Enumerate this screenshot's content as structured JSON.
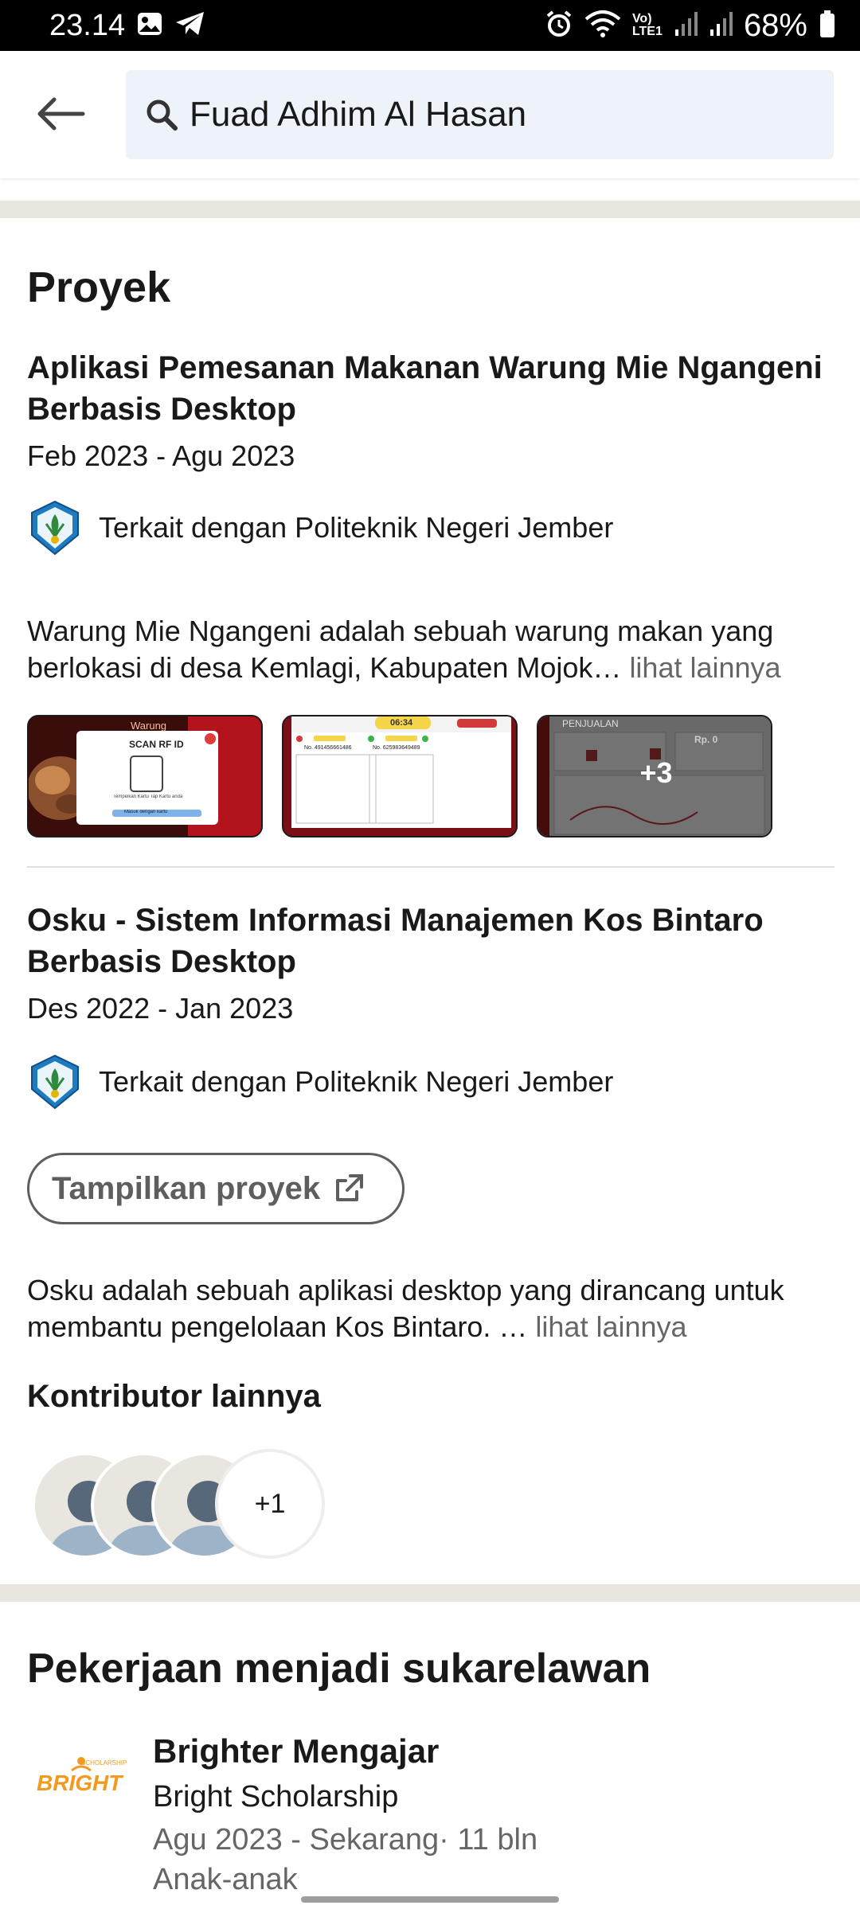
{
  "status_bar": {
    "time": "23.14",
    "battery": "68%",
    "network_label": "Vo) LTE1",
    "icons": [
      "gallery-icon",
      "telegram-icon",
      "alarm-icon",
      "wifi-icon",
      "signal-icon",
      "signal-icon",
      "battery-icon"
    ]
  },
  "header": {
    "search_text": "Fuad Adhim Al Hasan"
  },
  "projects": {
    "section_title": "Proyek",
    "items": [
      {
        "title": "Aplikasi Pemesanan Makanan Warung Mie Ngangeni Berbasis Desktop",
        "date": "Feb 2023 - Agu 2023",
        "associated": "Terkait dengan Politeknik Negeri Jember",
        "description": "Warung Mie Ngangeni adalah sebuah warung makan yang berlokasi di desa Kemlagi, Kabupaten Mojok…",
        "see_more": "lihat lainnya",
        "thumb1_title": "SCAN RF ID",
        "thumb1_caption": "Tempelkan Kartu Tap Kartu anda",
        "thumb1_button": "Masuk dengan kartu",
        "thumb1_banner": "Warung",
        "thumb2_timer": "06:34",
        "thumb2_no1": "No. 491456661486",
        "thumb2_no2": "No. 625983649489",
        "thumb3_title": "PENJUALAN",
        "thumb3_amount": "Rp. 0",
        "more_count": "+3"
      },
      {
        "title": "Osku - Sistem Informasi Manajemen Kos Bintaro Berbasis Desktop",
        "date": "Des 2022 - Jan 2023",
        "associated": "Terkait dengan Politeknik Negeri Jember",
        "show_project_label": "Tampilkan proyek",
        "description": "Osku adalah sebuah aplikasi desktop yang dirancang untuk membantu pengelolaan Kos Bintaro. …",
        "see_more": "lihat lainnya",
        "contributors_title": "Kontributor lainnya",
        "contributors_more": "+1"
      }
    ]
  },
  "volunteer": {
    "section_title": "Pekerjaan menjadi sukarelawan",
    "role": "Brighter Mengajar",
    "organization": "Bright Scholarship",
    "date": "Agu 2023 - Sekarang· 11 bln",
    "cause": "Anak-anak",
    "logo_word": "BRIGHT",
    "logo_small": "SCHOLARSHIP"
  },
  "colors": {
    "accent_gray": "#666666",
    "band": "#e9e5df",
    "search_bg": "#edf3f8",
    "bright_orange": "#f39a1e"
  }
}
